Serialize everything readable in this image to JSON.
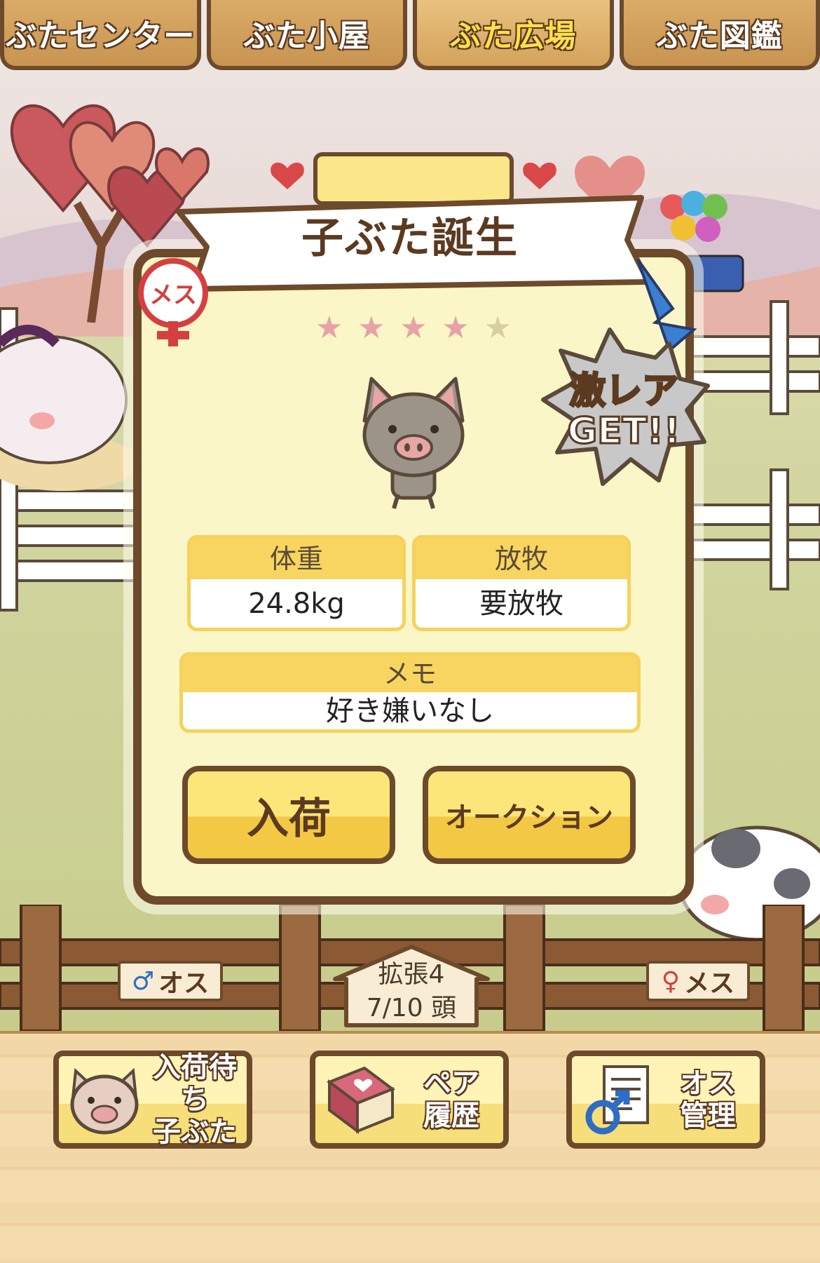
{
  "tabs": [
    {
      "label": "ぶたセンター",
      "active": false
    },
    {
      "label": "ぶた小屋",
      "active": false
    },
    {
      "label": "ぶた広場",
      "active": true
    },
    {
      "label": "ぶた図鑑",
      "active": false
    }
  ],
  "modal": {
    "title": "子ぶた誕生",
    "gender_badge": "メス",
    "rarity_stars_filled": 4,
    "rarity_stars_total": 5,
    "stars": [
      "★",
      "★",
      "★",
      "★",
      "★"
    ],
    "rare_banner": {
      "line1": "激レア",
      "line2": "GET!!"
    },
    "weight": {
      "label": "体重",
      "value": "24.8kg"
    },
    "pasture": {
      "label": "放牧",
      "value": "要放牧"
    },
    "memo": {
      "label": "メモ",
      "value": "好き嫌いなし"
    },
    "buttons": {
      "stock": "入荷",
      "auction": "オークション"
    }
  },
  "signs": {
    "male": {
      "symbol": "♂",
      "label": "オス"
    },
    "female": {
      "symbol": "♀",
      "label": "メス"
    }
  },
  "pen_counter": {
    "expansion": "拡張4",
    "count": "7/10 頭"
  },
  "bottom_buttons": [
    {
      "label_line1": "入荷待ち",
      "label_line2": "子ぶた",
      "icon": "piglet-face-icon"
    },
    {
      "label_line1": "ペア",
      "label_line2": "履歴",
      "icon": "heart-book-icon"
    },
    {
      "label_line1": "オス",
      "label_line2": "管理",
      "icon": "male-document-icon"
    }
  ],
  "colors": {
    "wood_dark": "#6d4a2c",
    "panel_bg": "#fbf6c8",
    "header_yellow": "#f7d560",
    "star_on": "#e7a2a6",
    "star_off": "#d8cf9e",
    "male_blue": "#2f6dc4",
    "female_red": "#d44040"
  }
}
